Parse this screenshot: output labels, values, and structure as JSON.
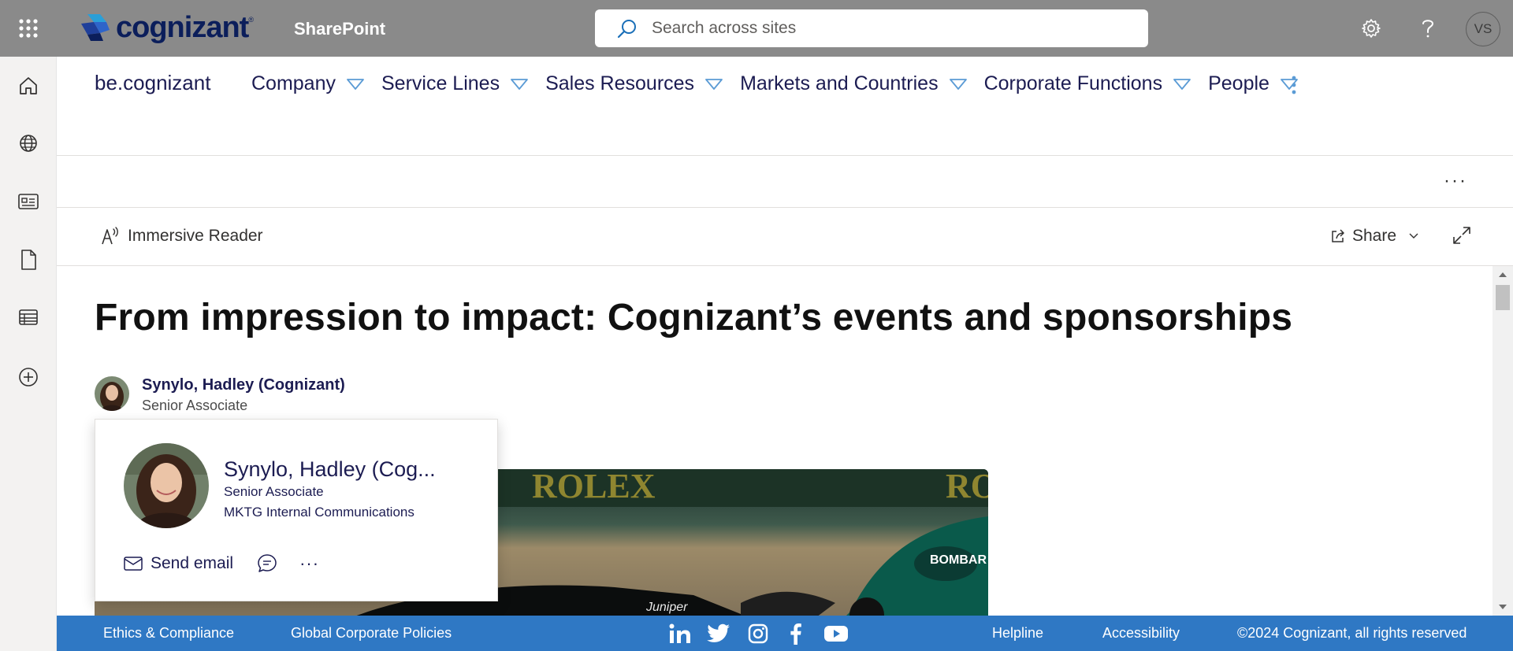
{
  "suitebar": {
    "brand": "cognizant",
    "brand_reg": "®",
    "app_name": "SharePoint",
    "search_placeholder": "Search across sites",
    "user_initials": "VS"
  },
  "site": {
    "title": "be.cognizant",
    "nav": [
      {
        "label": "Company"
      },
      {
        "label": "Service Lines"
      },
      {
        "label": "Sales Resources"
      },
      {
        "label": "Markets and Countries"
      },
      {
        "label": "Corporate Functions"
      },
      {
        "label": "People"
      }
    ]
  },
  "commandbar": {
    "more": "···",
    "immersive_reader": "Immersive Reader",
    "share": "Share"
  },
  "article": {
    "title": "From impression to impact: Cognizant’s events and sponsorships",
    "author_name": "Synylo, Hadley (Cognizant)",
    "author_role": "Senior Associate",
    "hero_text": {
      "banner": "ROLEX",
      "banner2": "RO",
      "sponsor": "BOMBAR",
      "car_text": "Juniper"
    }
  },
  "profile_card": {
    "name": "Synylo, Hadley (Cog...",
    "role": "Senior Associate",
    "department": "MKTG Internal Communications",
    "send_email": "Send email",
    "more": "···"
  },
  "footer": {
    "links_left": [
      "Ethics & Compliance",
      "Global Corporate Policies"
    ],
    "links_right": [
      "Helpline",
      "Accessibility"
    ],
    "copyright": "©2024 Cognizant, all rights reserved"
  },
  "colors": {
    "suitebar_bg": "#8a8a8a",
    "nav_text": "#1c1c52",
    "footer_bg": "#2f78c4",
    "nav_caret": "#5b9bd5"
  }
}
